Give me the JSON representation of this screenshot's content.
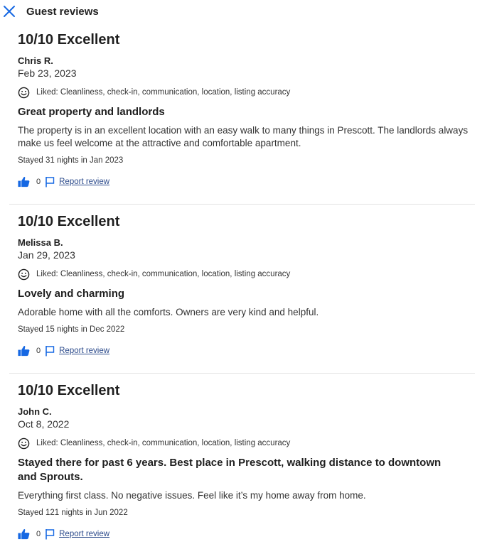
{
  "header": {
    "title": "Guest reviews"
  },
  "reviews": [
    {
      "rating": "10/10 Excellent",
      "author": "Chris R.",
      "date": "Feb 23, 2023",
      "liked": "Liked: Cleanliness, check-in, communication, location, listing accuracy",
      "title": "Great property and landlords",
      "body": "The property is in an excellent location with an easy walk to many things in Prescott. The landlords always make us feel welcome at the attractive and comfortable apartment.",
      "stayed": "Stayed 31 nights in Jan 2023",
      "likes": "0",
      "report": "Report review"
    },
    {
      "rating": "10/10 Excellent",
      "author": "Melissa B.",
      "date": "Jan 29, 2023",
      "liked": "Liked: Cleanliness, check-in, communication, location, listing accuracy",
      "title": "Lovely and charming",
      "body": "Adorable home with all the comforts. Owners are very kind and helpful.",
      "stayed": "Stayed 15 nights in Dec 2022",
      "likes": "0",
      "report": "Report review"
    },
    {
      "rating": "10/10 Excellent",
      "author": "John C.",
      "date": "Oct 8, 2022",
      "liked": "Liked: Cleanliness, check-in, communication, location, listing accuracy",
      "title": "Stayed there for past 6 years. Best place in Prescott, walking distance to downtown and Sprouts.",
      "body": "Everything first class. No negative issues. Feel like it’s my home away from home.",
      "stayed": "Stayed 121 nights in Jun 2022",
      "likes": "0",
      "report": "Report review"
    }
  ],
  "icons": {
    "close": "close-icon",
    "smile": "smile-icon",
    "like": "thumbs-up-icon",
    "report": "flag-icon"
  },
  "colors": {
    "accent": "#1668e3",
    "text": "#1f1f1f",
    "link": "#2b4a8b",
    "divider": "#e3e3e3"
  }
}
